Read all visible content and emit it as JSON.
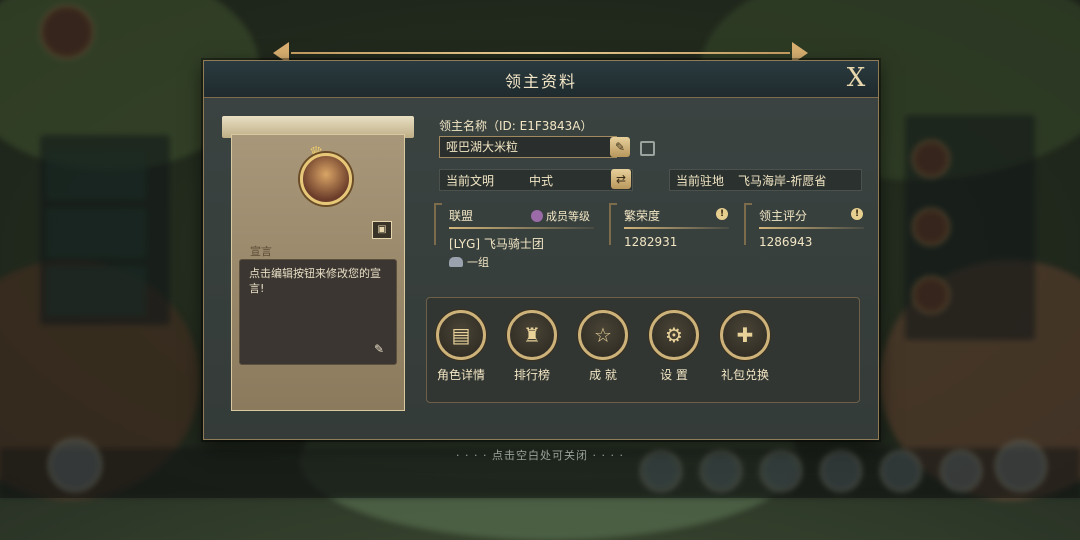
{
  "dialog": {
    "title": "领主资料",
    "close_label": "X"
  },
  "lord": {
    "name_label": "领主名称（ID: E1F3843A）",
    "name_value": "哑巴湖大米粒",
    "civilization_label": "当前文明",
    "civilization_value": "中式",
    "location_label": "当前驻地",
    "location_value": "飞马海岸-祈愿省",
    "manifesto_label": "宣言",
    "manifesto_text": "点击编辑按钮来修改您的宣言!"
  },
  "alliance": {
    "label": "联盟",
    "rank_label": "成员等级",
    "name": "[LYG] 飞马骑士团",
    "group": "一组"
  },
  "prosperity": {
    "label": "繁荣度",
    "value": "1282931"
  },
  "rating": {
    "label": "领主评分",
    "value": "1286943"
  },
  "actions": [
    {
      "label": "角色详情",
      "icon": "cards-icon"
    },
    {
      "label": "排行榜",
      "icon": "trophy-icon"
    },
    {
      "label": "成 就",
      "icon": "star-medal-icon"
    },
    {
      "label": "设 置",
      "icon": "gear-icon"
    },
    {
      "label": "礼包兑换",
      "icon": "gift-icon"
    }
  ],
  "hint": "· · · · 点击空白处可关闭 · · · ·"
}
